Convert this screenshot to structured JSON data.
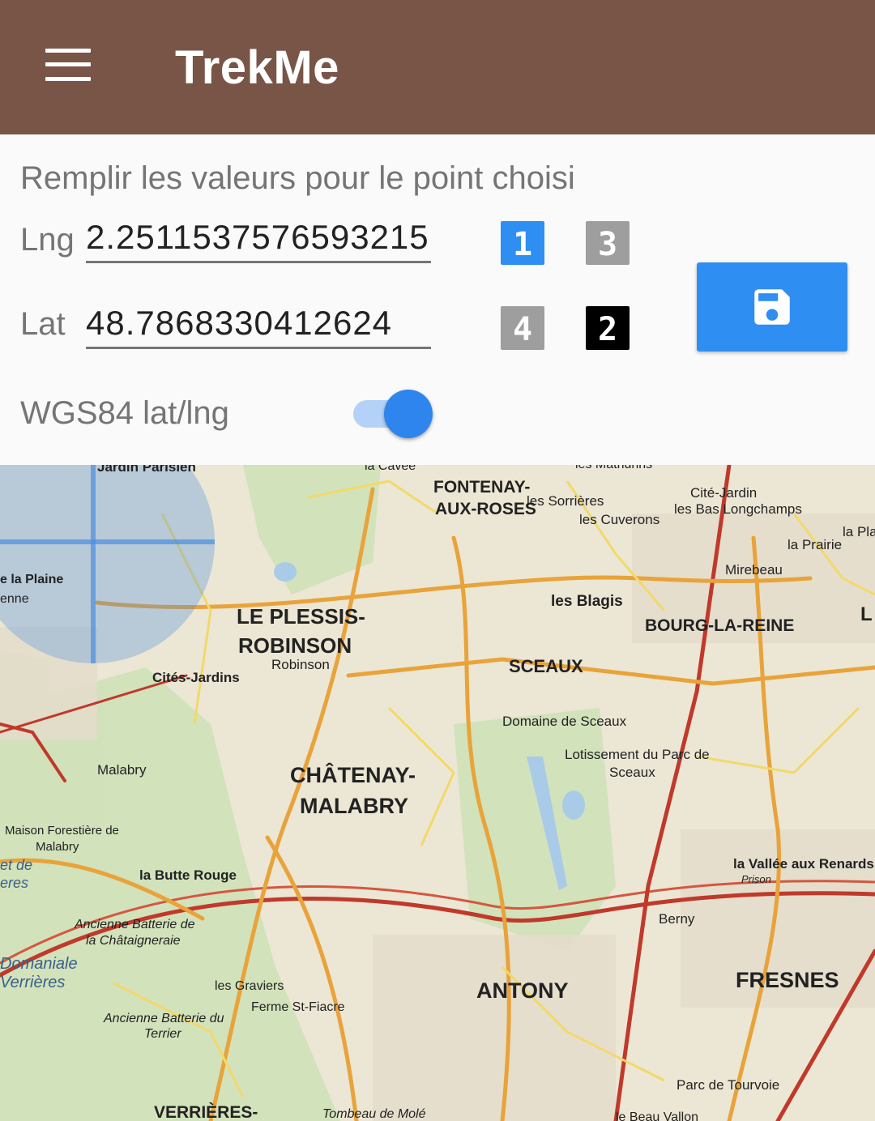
{
  "app": {
    "title": "TrekMe"
  },
  "panel": {
    "instruction": "Remplir les valeurs pour le point choisi",
    "lng_label": "Lng",
    "lng_value": "2.2511537576593215",
    "lat_label": "Lat",
    "lat_value": "48.7868330412624",
    "toggle_label": "WGS84 lat/lng",
    "toggle_on": true,
    "calibration_points": [
      {
        "number": "1",
        "state": "selected",
        "color": "#2f8ef2"
      },
      {
        "number": "3",
        "state": "inactive",
        "color": "#9e9e9e"
      },
      {
        "number": "4",
        "state": "inactive",
        "color": "#9e9e9e"
      },
      {
        "number": "2",
        "state": "defined",
        "color": "#000000"
      }
    ],
    "save_icon": "save-icon"
  },
  "map": {
    "labels": {
      "fontenay": "FONTENAY-",
      "aux_roses": "AUX-ROSES",
      "sorrieres": "les Sorrières",
      "cuverons": "les Cuverons",
      "cite_jardin": "Cité-Jardin",
      "bas_longchamps": "les Bas Longchamps",
      "la_prairie": "la Prairie",
      "la_pla": "la Pla",
      "mirebeau": "Mirebeau",
      "plessis": "LE PLESSIS-",
      "robinson": "ROBINSON",
      "robinson_small": "Robinson",
      "les_blagis": "les Blagis",
      "bourg_la_reine": "BOURG-LA-REINE",
      "sceaux": "SCEAUX",
      "cites_jardins": "Cités-Jardins",
      "domaine_sceaux": "Domaine de Sceaux",
      "lotissement": "Lotissement du Parc de",
      "sceaux_small": "Sceaux",
      "malabry": "Malabry",
      "chatenay": "CHÂTENAY-",
      "malabry_big": "MALABRY",
      "maison_forestiere": "Maison Forestière de",
      "malabry_small": "Malabry",
      "la_butte_rouge": "la Butte Rouge",
      "vallee_renards": "la Vallée aux Renards",
      "prison": "Prison",
      "berny": "Berny",
      "ancienne_batterie": "Ancienne Batterie de",
      "chataigneraie": "la Châtaigneraie",
      "domaniale": "Domaniale",
      "verrieres_small": "Verrières",
      "les_graviers": "les Graviers",
      "ferme_st_fiacre": "Ferme St-Fiacre",
      "antony": "ANTONY",
      "fresnes": "FRESNES",
      "ancienne_batterie_du": "Ancienne Batterie du",
      "terrier": "Terrier",
      "verrieres_big": "VERRIÈRES-",
      "tombeau": "Tombeau de Molé",
      "parc_tourvoie": "Parc de Tourvoie",
      "beau_vallon": "le Beau Vallon",
      "la_plaine": "e la Plaine",
      "jardin_parisien": "Jardin Parisien",
      "et_de": "et de",
      "eres": "eres",
      "enne": "enne",
      "la_cavee": "la Cavée",
      "les_mathurins": "les Mathurins",
      "l_partial": "L"
    }
  }
}
